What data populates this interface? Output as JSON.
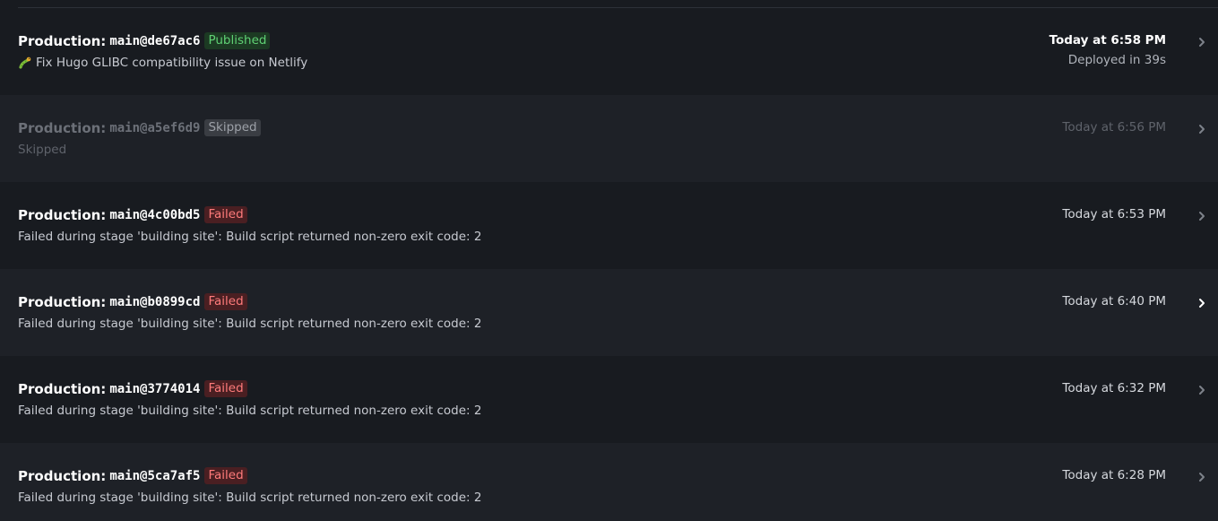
{
  "colors": {
    "background": "#181b20",
    "row_alt": "#1e2127",
    "published": "#5fd174",
    "failed": "#ff7b7b",
    "skipped": "#9da1a8"
  },
  "deploys": [
    {
      "env": "Production:",
      "ref": "main@de67ac6",
      "status": "Published",
      "status_kind": "published",
      "message": "Fix Hugo GLIBC compatibility issue on Netlify",
      "icon": "bug-icon",
      "time": "Today at 6:58 PM",
      "duration": "Deployed in 39s"
    },
    {
      "env": "Production:",
      "ref": "main@a5ef6d9",
      "status": "Skipped",
      "status_kind": "skipped",
      "message": "Skipped",
      "time": "Today at 6:56 PM"
    },
    {
      "env": "Production:",
      "ref": "main@4c00bd5",
      "status": "Failed",
      "status_kind": "failed",
      "message": "Failed during stage 'building site': Build script returned non-zero exit code: 2",
      "time": "Today at 6:53 PM"
    },
    {
      "env": "Production:",
      "ref": "main@b0899cd",
      "status": "Failed",
      "status_kind": "failed",
      "message": "Failed during stage 'building site': Build script returned non-zero exit code: 2",
      "time": "Today at 6:40 PM"
    },
    {
      "env": "Production:",
      "ref": "main@3774014",
      "status": "Failed",
      "status_kind": "failed",
      "message": "Failed during stage 'building site': Build script returned non-zero exit code: 2",
      "time": "Today at 6:32 PM"
    },
    {
      "env": "Production:",
      "ref": "main@5ca7af5",
      "status": "Failed",
      "status_kind": "failed",
      "message": "Failed during stage 'building site': Build script returned non-zero exit code: 2",
      "time": "Today at 6:28 PM"
    }
  ]
}
